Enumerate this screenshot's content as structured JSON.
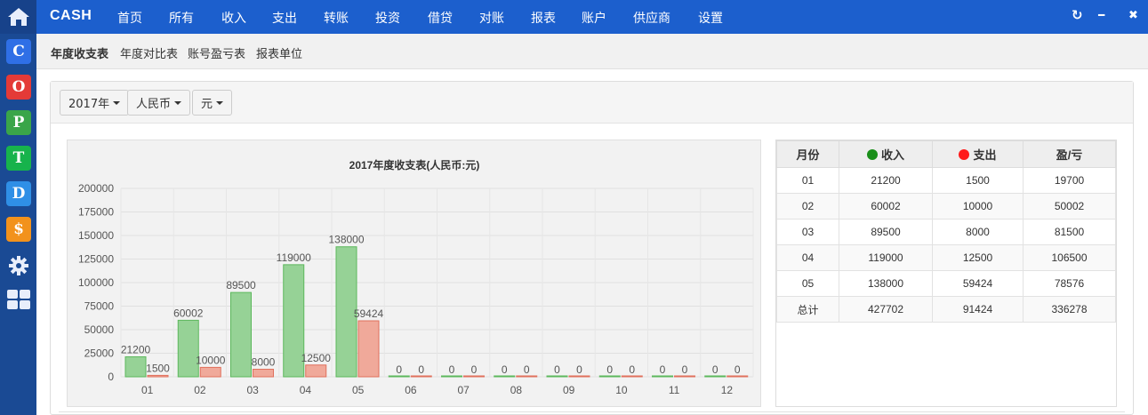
{
  "app": {
    "brand": "CASH"
  },
  "nav": {
    "items": [
      "首页",
      "所有",
      "收入",
      "支出",
      "转账",
      "投资",
      "借贷",
      "对账",
      "报表",
      "账户",
      "供应商",
      "设置"
    ]
  },
  "window_controls": {
    "refresh": "↻",
    "minimize": "━",
    "close": "✖"
  },
  "subnav": {
    "items": [
      "年度收支表",
      "年度对比表",
      "账号盈亏表",
      "报表单位"
    ],
    "active_index": 0
  },
  "filters": {
    "year": "2017年",
    "currency": "人民币",
    "unit": "元"
  },
  "sidebar_icons": [
    {
      "name": "c-app-icon",
      "glyph": "C",
      "color": "#2f6fe6"
    },
    {
      "name": "o-app-icon",
      "glyph": "O",
      "color": "#e43a37"
    },
    {
      "name": "p-app-icon",
      "glyph": "P",
      "color": "#3aa549"
    },
    {
      "name": "t-app-icon",
      "glyph": "T",
      "color": "#17b34c"
    },
    {
      "name": "d-app-icon",
      "glyph": "D",
      "color": "#2f8fe6"
    },
    {
      "name": "dollar-app-icon",
      "glyph": "$",
      "color": "#f2921c"
    }
  ],
  "colors": {
    "nav": "#1c5fcd",
    "sidebar": "#1a4a94",
    "income": "#1a8f1a",
    "expense": "#ff1a1a",
    "income_bar": "#96d296",
    "expense_bar": "#f0a99a"
  },
  "chart_data": {
    "type": "bar",
    "title": "2017年度收支表(人民币:元)",
    "categories": [
      "01",
      "02",
      "03",
      "04",
      "05",
      "06",
      "07",
      "08",
      "09",
      "10",
      "11",
      "12"
    ],
    "series": [
      {
        "name": "收入",
        "values": [
          21200,
          60002,
          89500,
          119000,
          138000,
          0,
          0,
          0,
          0,
          0,
          0,
          0
        ]
      },
      {
        "name": "支出",
        "values": [
          1500,
          10000,
          8000,
          12500,
          59424,
          0,
          0,
          0,
          0,
          0,
          0,
          0
        ]
      }
    ],
    "yticks": [
      "0",
      "25000",
      "50000",
      "75000",
      "100000",
      "125000",
      "150000",
      "175000",
      "200000"
    ],
    "ylim": [
      0,
      200000
    ],
    "grid": true,
    "xlabel": "",
    "ylabel": ""
  },
  "table": {
    "headers": {
      "month": "月份",
      "income": "收入",
      "expense": "支出",
      "profit": "盈/亏"
    },
    "rows": [
      {
        "month": "01",
        "income": "21200",
        "expense": "1500",
        "profit": "19700"
      },
      {
        "month": "02",
        "income": "60002",
        "expense": "10000",
        "profit": "50002"
      },
      {
        "month": "03",
        "income": "89500",
        "expense": "8000",
        "profit": "81500"
      },
      {
        "month": "04",
        "income": "119000",
        "expense": "12500",
        "profit": "106500"
      },
      {
        "month": "05",
        "income": "138000",
        "expense": "59424",
        "profit": "78576"
      },
      {
        "month": "总计",
        "income": "427702",
        "expense": "91424",
        "profit": "336278"
      }
    ]
  }
}
